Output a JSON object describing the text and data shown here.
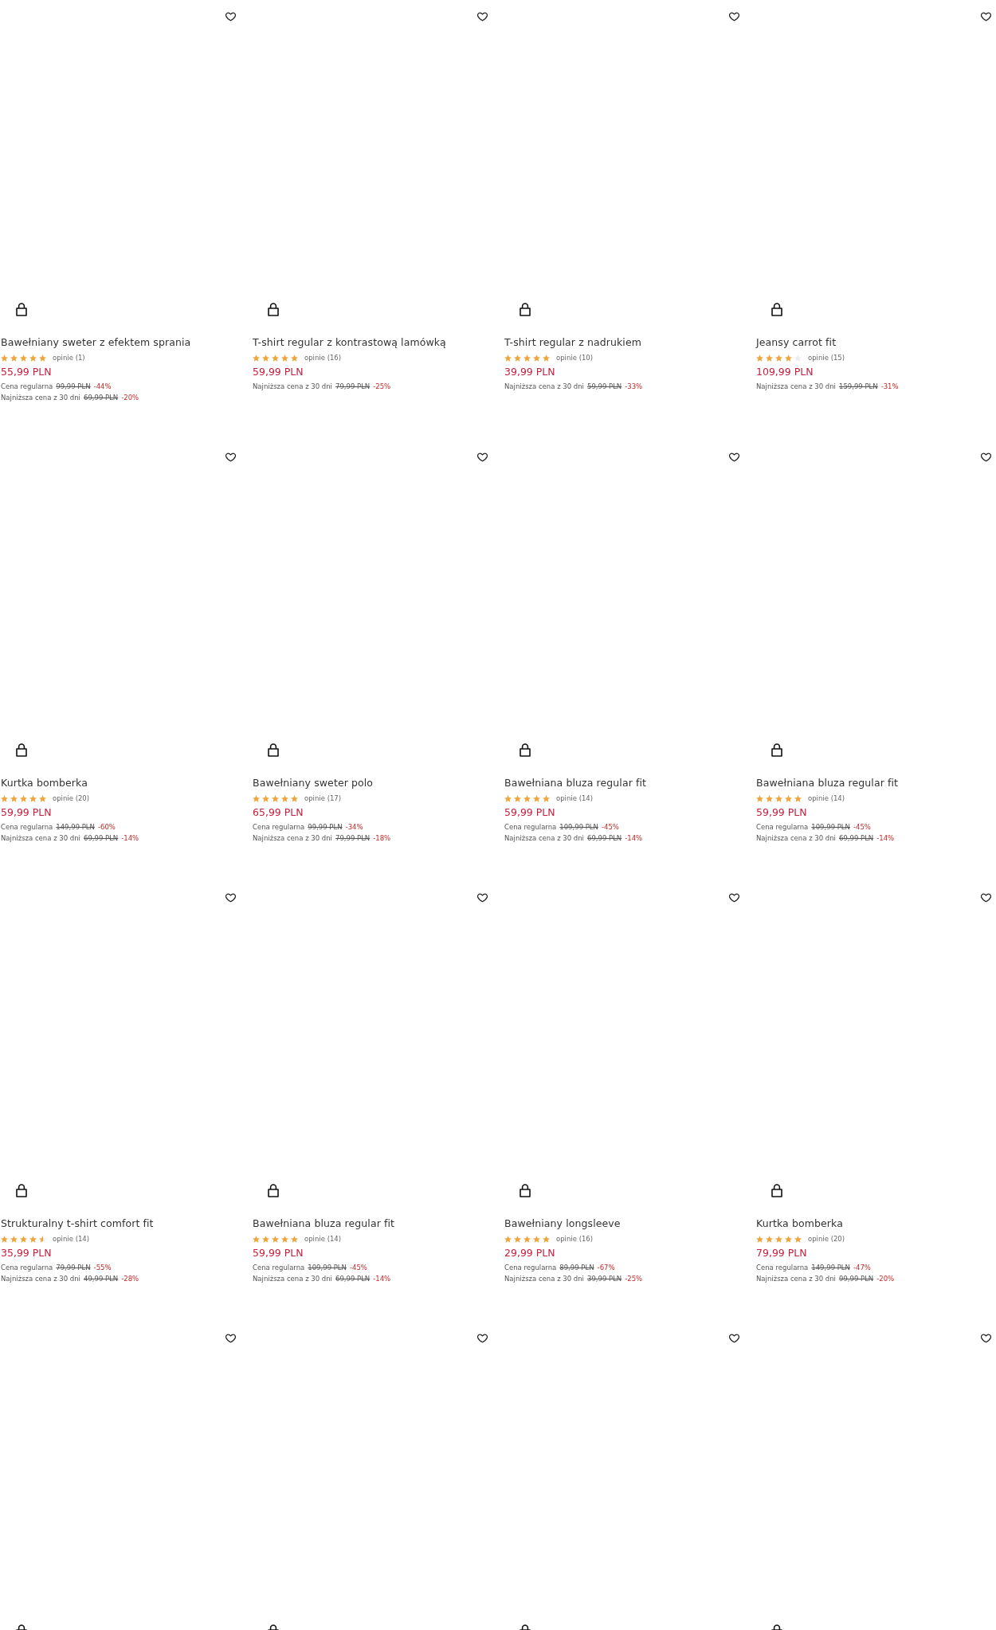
{
  "products": [
    {
      "favorite": false,
      "title": "Bawełniany sweter z efektem sprania",
      "stars": 5,
      "reviews": "opinie (1)",
      "price": "55,99 PLN",
      "price_notes": [
        {
          "label": "Cena regularna",
          "old_price": "99,99 PLN",
          "discount": "-44%"
        },
        {
          "label": "Najniższa cena z 30 dni",
          "old_price": "69,99 PLN",
          "discount": "-20%"
        }
      ]
    },
    {
      "favorite": false,
      "title": "T-shirt regular z kontrastową lamówką",
      "stars": 5,
      "reviews": "opinie (16)",
      "price": "59,99 PLN",
      "price_notes": [
        {
          "label": "Najniższa cena z 30 dni",
          "old_price": "79,99 PLN",
          "discount": "-25%"
        }
      ]
    },
    {
      "favorite": false,
      "title": "T-shirt regular z nadrukiem",
      "stars": 5,
      "reviews": "opinie (10)",
      "price": "39,99 PLN",
      "price_notes": [
        {
          "label": "Najniższa cena z 30 dni",
          "old_price": "59,99 PLN",
          "discount": "-33%"
        }
      ]
    },
    {
      "favorite": false,
      "title": "Jeansy carrot fit",
      "stars": 4,
      "reviews": "opinie (15)",
      "price": "109,99 PLN",
      "price_notes": [
        {
          "label": "Najniższa cena z 30 dni",
          "old_price": "159,99 PLN",
          "discount": "-31%"
        }
      ]
    },
    {
      "favorite": false,
      "title": "Kurtka bomberka",
      "stars": 5,
      "reviews": "opinie (20)",
      "price": "59,99 PLN",
      "price_notes": [
        {
          "label": "Cena regularna",
          "old_price": "149,99 PLN",
          "discount": "-60%"
        },
        {
          "label": "Najniższa cena z 30 dni",
          "old_price": "69,99 PLN",
          "discount": "-14%"
        }
      ]
    },
    {
      "favorite": false,
      "title": "Bawełniany sweter polo",
      "stars": 5,
      "reviews": "opinie (17)",
      "price": "65,99 PLN",
      "price_notes": [
        {
          "label": "Cena regularna",
          "old_price": "99,99 PLN",
          "discount": "-34%"
        },
        {
          "label": "Najniższa cena z 30 dni",
          "old_price": "79,99 PLN",
          "discount": "-18%"
        }
      ]
    },
    {
      "favorite": false,
      "title": "Bawełniana bluza regular fit",
      "stars": 5,
      "reviews": "opinie (14)",
      "price": "59,99 PLN",
      "price_notes": [
        {
          "label": "Cena regularna",
          "old_price": "109,99 PLN",
          "discount": "-45%"
        },
        {
          "label": "Najniższa cena z 30 dni",
          "old_price": "69,99 PLN",
          "discount": "-14%"
        }
      ]
    },
    {
      "favorite": false,
      "title": "Bawełniana bluza regular fit",
      "stars": 5,
      "reviews": "opinie (14)",
      "price": "59,99 PLN",
      "price_notes": [
        {
          "label": "Cena regularna",
          "old_price": "109,99 PLN",
          "discount": "-45%"
        },
        {
          "label": "Najniższa cena z 30 dni",
          "old_price": "69,99 PLN",
          "discount": "-14%"
        }
      ]
    },
    {
      "favorite": false,
      "title": "Strukturalny t-shirt comfort fit",
      "stars": 4.5,
      "reviews": "opinie (14)",
      "price": "35,99 PLN",
      "price_notes": [
        {
          "label": "Cena regularna",
          "old_price": "79,99 PLN",
          "discount": "-55%"
        },
        {
          "label": "Najniższa cena z 30 dni",
          "old_price": "49,99 PLN",
          "discount": "-28%"
        }
      ]
    },
    {
      "favorite": false,
      "title": "Bawełniana bluza regular fit",
      "stars": 5,
      "reviews": "opinie (14)",
      "price": "59,99 PLN",
      "price_notes": [
        {
          "label": "Cena regularna",
          "old_price": "109,99 PLN",
          "discount": "-45%"
        },
        {
          "label": "Najniższa cena z 30 dni",
          "old_price": "69,99 PLN",
          "discount": "-14%"
        }
      ]
    },
    {
      "favorite": false,
      "title": "Bawełniany longsleeve",
      "stars": 5,
      "reviews": "opinie (16)",
      "price": "29,99 PLN",
      "price_notes": [
        {
          "label": "Cena regularna",
          "old_price": "89,99 PLN",
          "discount": "-67%"
        },
        {
          "label": "Najniższa cena z 30 dni",
          "old_price": "39,99 PLN",
          "discount": "-25%"
        }
      ]
    },
    {
      "favorite": false,
      "title": "Kurtka bomberka",
      "stars": 5,
      "reviews": "opinie (20)",
      "price": "79,99 PLN",
      "price_notes": [
        {
          "label": "Cena regularna",
          "old_price": "149,99 PLN",
          "discount": "-47%"
        },
        {
          "label": "Najniższa cena z 30 dni",
          "old_price": "99,99 PLN",
          "discount": "-20%"
        }
      ]
    },
    {
      "favorite": false
    },
    {
      "favorite": false
    },
    {
      "favorite": false
    },
    {
      "favorite": false
    }
  ]
}
